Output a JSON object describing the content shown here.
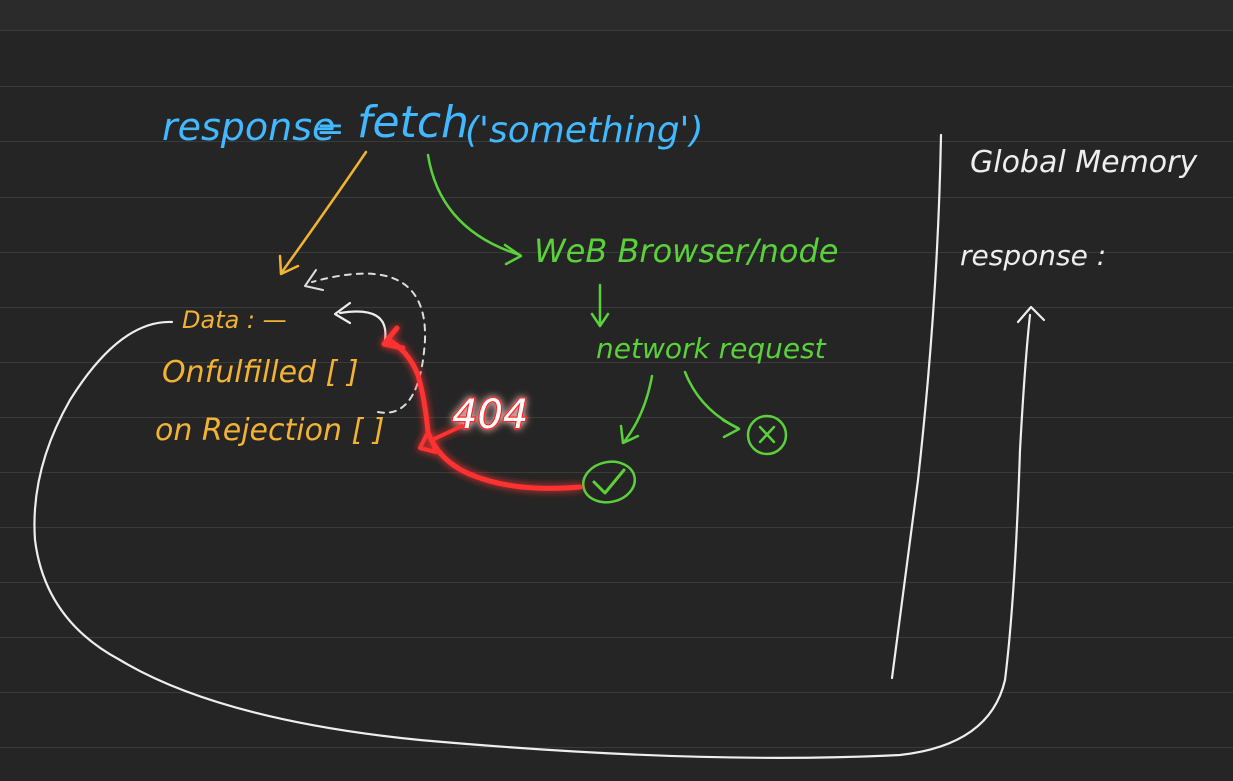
{
  "code": {
    "var_name": "response",
    "equals": "=",
    "call": "fetch",
    "argument": "('something')"
  },
  "promise": {
    "data_label": "Data : —",
    "fulfilled_label": "Onfulfilled [ ]",
    "rejection_label": "on Rejection [ ]"
  },
  "browser": {
    "label": "WeB Browser/node",
    "request_label": "network request"
  },
  "status": {
    "code": "404"
  },
  "memory": {
    "title": "Global Memory",
    "entry": "response :"
  },
  "colors": {
    "background": "#252525",
    "ruled_line": "#3a3a3a",
    "blue": "#41b8ff",
    "orange": "#f2b233",
    "green": "#5ad13b",
    "white": "#eeeeee",
    "red": "#ff2020",
    "red_glow": "#ff4a4a"
  },
  "icons": {
    "success": "check-circle-icon",
    "failure": "x-circle-icon"
  }
}
